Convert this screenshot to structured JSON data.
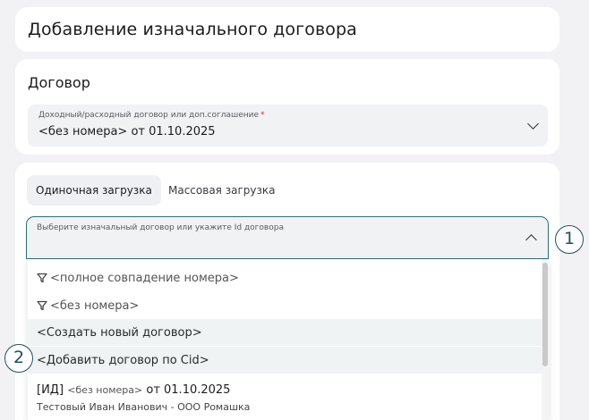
{
  "page": {
    "title": "Добавление изначального договора"
  },
  "contract_section": {
    "heading": "Договор",
    "field_label": "Доходный/расходный договор или доп.соглашение",
    "required_mark": "*",
    "field_value": "<без номера> от 01.10.2025"
  },
  "upload_section": {
    "tabs": [
      {
        "label": "Одиночная загрузка",
        "active": true
      },
      {
        "label": "Массовая загрузка",
        "active": false
      }
    ],
    "search_label": "Выберите изначальный договор или укажите Id договора",
    "options": [
      {
        "label": "<полное совпадение номера>",
        "icon": "filter-icon"
      },
      {
        "label": "<без номера>",
        "icon": "filter-icon"
      },
      {
        "label": "<Создать новый договор>"
      },
      {
        "label": "<Добавить договор по Cid>"
      }
    ],
    "contract_option": {
      "prefix": "[ИД]",
      "number": "<без номера>",
      "date": "от 01.10.2025",
      "parties": "Тестовый Иван Иванович - ООО Ромашка"
    }
  },
  "callouts": [
    "1",
    "2"
  ],
  "colors": {
    "accent_border": "#2f6f73",
    "required": "#e0263d",
    "highlight": "#eff3f3",
    "callout": "#1f4f63"
  }
}
